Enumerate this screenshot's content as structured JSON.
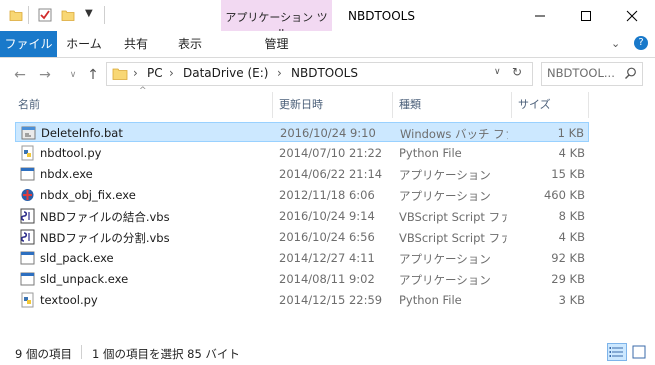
{
  "window": {
    "title": "NBDTOOLS",
    "context_tab_group": "アプリケーション ツール",
    "controls": {
      "minimize": "—",
      "maximize": "☐",
      "close": "✕"
    }
  },
  "ribbon": {
    "tabs": [
      {
        "label": "ファイル",
        "active": true
      },
      {
        "label": "ホーム"
      },
      {
        "label": "共有"
      },
      {
        "label": "表示"
      },
      {
        "label": "管理"
      }
    ],
    "expand_icon": "chevron-down-icon",
    "help_icon": "help-icon"
  },
  "address": {
    "path": [
      "PC",
      "DataDrive (E:)",
      "NBDTOOLS"
    ],
    "separator": "›",
    "search_placeholder": "NBDTOOL..."
  },
  "columns": {
    "name": "名前",
    "date": "更新日時",
    "type": "種類",
    "size": "サイズ"
  },
  "files": [
    {
      "name": "DeleteInfo.bat",
      "date": "2016/10/24 9:10",
      "type": "Windows バッチ ファイル",
      "size": "1 KB",
      "icon": "batch-file-icon",
      "selected": true
    },
    {
      "name": "nbdtool.py",
      "date": "2014/07/10 21:22",
      "type": "Python File",
      "size": "4 KB",
      "icon": "python-file-icon"
    },
    {
      "name": "nbdx.exe",
      "date": "2014/06/22 21:14",
      "type": "アプリケーション",
      "size": "15 KB",
      "icon": "exe-file-icon"
    },
    {
      "name": "nbdx_obj_fix.exe",
      "date": "2012/11/18 6:06",
      "type": "アプリケーション",
      "size": "460 KB",
      "icon": "app-special-icon"
    },
    {
      "name": "NBDファイルの結合.vbs",
      "date": "2016/10/24 9:14",
      "type": "VBScript Script ファイル",
      "size": "8 KB",
      "icon": "vbs-file-icon"
    },
    {
      "name": "NBDファイルの分割.vbs",
      "date": "2016/10/24 6:56",
      "type": "VBScript Script ファイル",
      "size": "4 KB",
      "icon": "vbs-file-icon"
    },
    {
      "name": "sld_pack.exe",
      "date": "2014/12/27 4:11",
      "type": "アプリケーション",
      "size": "92 KB",
      "icon": "exe-file-icon"
    },
    {
      "name": "sld_unpack.exe",
      "date": "2014/08/11 9:02",
      "type": "アプリケーション",
      "size": "29 KB",
      "icon": "exe-file-icon"
    },
    {
      "name": "textool.py",
      "date": "2014/12/15 22:59",
      "type": "Python File",
      "size": "3 KB",
      "icon": "python-file-icon"
    }
  ],
  "status": {
    "item_count": "9 個の項目",
    "selection": "1 個の項目を選択  85 バイト"
  },
  "colors": {
    "file_tab": "#1979ca",
    "context_tab": "#f2d9f2",
    "selection": "#cce8ff",
    "selection_border": "#99d1ff"
  }
}
